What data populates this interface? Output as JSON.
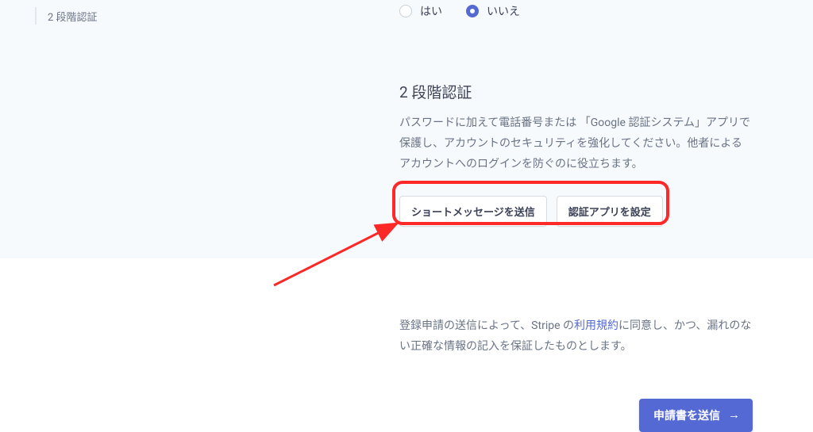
{
  "sidebar": {
    "item_label": "2 段階認証"
  },
  "radio": {
    "yes": "はい",
    "no": "いいえ"
  },
  "section": {
    "heading": "2 段階認証",
    "description": "パスワードに加えて電話番号または 「Google 認証システム」アプリで保護し、アカウントのセキュリティを強化してください。他者によるアカウントへのログインを防ぐのに役立ちます。"
  },
  "buttons": {
    "send_sms": "ショートメッセージを送信",
    "setup_app": "認証アプリを設定"
  },
  "agreement": {
    "pre": "登録申請の送信によって、Stripe の",
    "link": "利用規約",
    "post": "に同意し、かつ、漏れのない正確な情報の記入を保証したものとします。"
  },
  "submit": {
    "label": "申請書を送信"
  }
}
